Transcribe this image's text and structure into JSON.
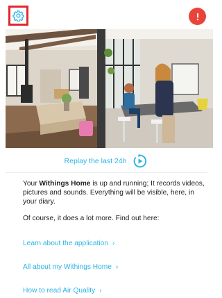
{
  "header": {
    "settings_icon": "gear-icon",
    "alert_icon": "exclamation-icon",
    "highlight_color": "#e3262f",
    "alert_color": "#e9443a"
  },
  "video": {
    "scene": "living-room-camera-view"
  },
  "replay": {
    "label": "Replay the last 24h",
    "icon": "replay-icon",
    "color": "#2bb3e6"
  },
  "intro": {
    "part1": "Your ",
    "brand": "Withings Home",
    "part2": " is up and running; It records videos, pictures and sounds. Everything will be visible, here, in your diary."
  },
  "subtext": "Of course, it does a lot more. Find out here:",
  "links": [
    {
      "label": "Learn about the application",
      "chevron": "›"
    },
    {
      "label": "All about my Withings Home",
      "chevron": "›"
    },
    {
      "label": "How to read Air Quality",
      "chevron": "›"
    }
  ]
}
